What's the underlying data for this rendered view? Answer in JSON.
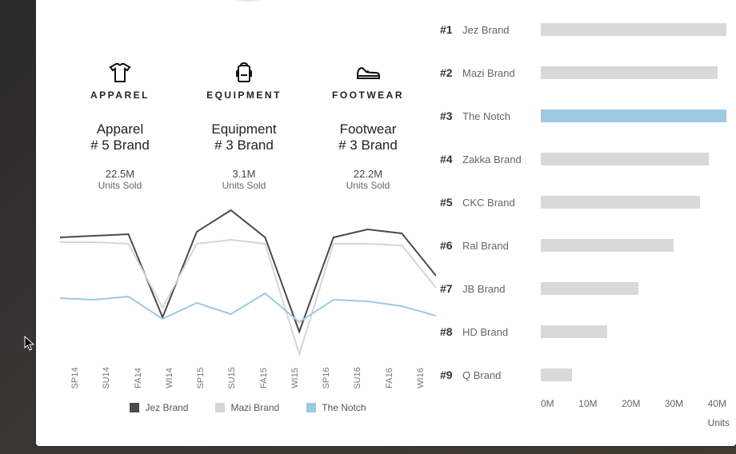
{
  "colors": {
    "jez": "#4a4a4a",
    "mazi": "#d6d6d6",
    "notch": "#9ec9e2"
  },
  "categories": [
    {
      "key": "apparel",
      "label": "APPAREL",
      "title": "Apparel",
      "rank": "# 5 Brand",
      "value": "22.5M",
      "sub": "Units Sold"
    },
    {
      "key": "equipment",
      "label": "EQUIPMENT",
      "title": "Equipment",
      "rank": "# 3 Brand",
      "value": "3.1M",
      "sub": "Units Sold"
    },
    {
      "key": "footwear",
      "label": "FOOTWEAR",
      "title": "Footwear",
      "rank": "# 3 Brand",
      "value": "22.2M",
      "sub": "Units Sold"
    }
  ],
  "legend": {
    "jez": "Jez Brand",
    "mazi": "Mazi Brand",
    "notch": "The Notch"
  },
  "units_axis": [
    "0M",
    "10M",
    "20M",
    "30M",
    "40M"
  ],
  "units_label": "Units",
  "ranking": [
    {
      "rank": "#1",
      "name": "Jez Brand",
      "units": 42,
      "highlight": false
    },
    {
      "rank": "#2",
      "name": "Mazi Brand",
      "units": 40,
      "highlight": false
    },
    {
      "rank": "#3",
      "name": "The Notch",
      "units": 42,
      "highlight": true
    },
    {
      "rank": "#4",
      "name": "Zakka Brand",
      "units": 38,
      "highlight": false
    },
    {
      "rank": "#5",
      "name": "CKC Brand",
      "units": 36,
      "highlight": false
    },
    {
      "rank": "#6",
      "name": "Ral Brand",
      "units": 30,
      "highlight": false
    },
    {
      "rank": "#7",
      "name": "JB Brand",
      "units": 22,
      "highlight": false
    },
    {
      "rank": "#8",
      "name": "HD Brand",
      "units": 15,
      "highlight": false
    },
    {
      "rank": "#9",
      "name": "Q Brand",
      "units": 7,
      "highlight": false
    }
  ],
  "chart_data": {
    "type": "line",
    "title": "",
    "categories": [
      "SP14",
      "SU14",
      "FA14",
      "WI14",
      "SP15",
      "SU15",
      "FA15",
      "WI15",
      "SP16",
      "SU16",
      "FA16",
      "WI16"
    ],
    "series": [
      {
        "name": "Jez Brand",
        "values": [
          158,
          160,
          162,
          58,
          165,
          192,
          158,
          40,
          158,
          168,
          163,
          110
        ]
      },
      {
        "name": "Mazi Brand",
        "values": [
          152,
          152,
          150,
          70,
          150,
          155,
          150,
          12,
          150,
          150,
          148,
          95
        ]
      },
      {
        "name": "The Notch",
        "values": [
          82,
          80,
          84,
          56,
          76,
          62,
          88,
          52,
          80,
          78,
          72,
          60
        ]
      }
    ],
    "xlabel": "",
    "ylabel": "",
    "ylim": [
      0,
      200
    ]
  }
}
